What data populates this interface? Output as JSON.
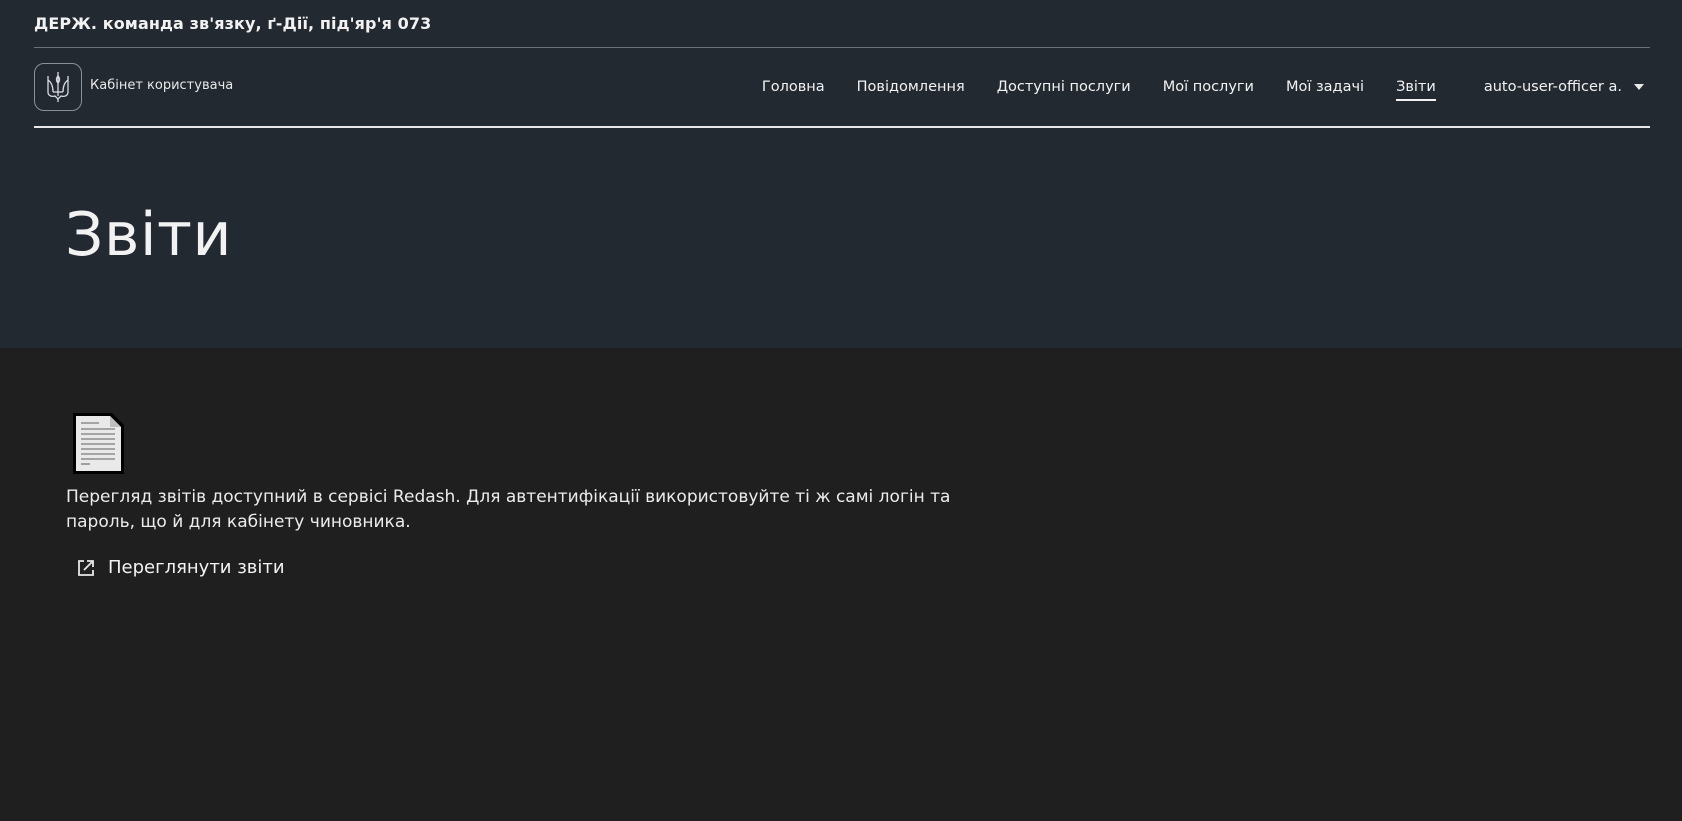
{
  "org": {
    "name": "ДЕРЖ. команда зв'язку, ґ-Дії, під'яр'я 073"
  },
  "header": {
    "logo_label": "Кабінет користувача",
    "nav": [
      {
        "label": "Головна"
      },
      {
        "label": "Повідомлення"
      },
      {
        "label": "Доступні послуги"
      },
      {
        "label": "Мої послуги"
      },
      {
        "label": "Мої задачі"
      },
      {
        "label": "Звіти",
        "active": true
      }
    ],
    "user": {
      "name": "auto-user-officer a."
    }
  },
  "main": {
    "title": "Звіти",
    "description": "Перегляд звітів доступний в сервісі Redash. Для автентифікації використовуйте ті ж самі логін та пароль, що й для кабінету чиновника.",
    "link_label": "Переглянути звіти"
  },
  "icons": {
    "logo": "trident-icon",
    "document": "document-icon",
    "external_link": "external-link-icon",
    "caret": "chevron-down-icon"
  },
  "colors": {
    "header_bg": "#232931",
    "page_bg": "#1f1f1f",
    "text": "#f2f2f2"
  }
}
